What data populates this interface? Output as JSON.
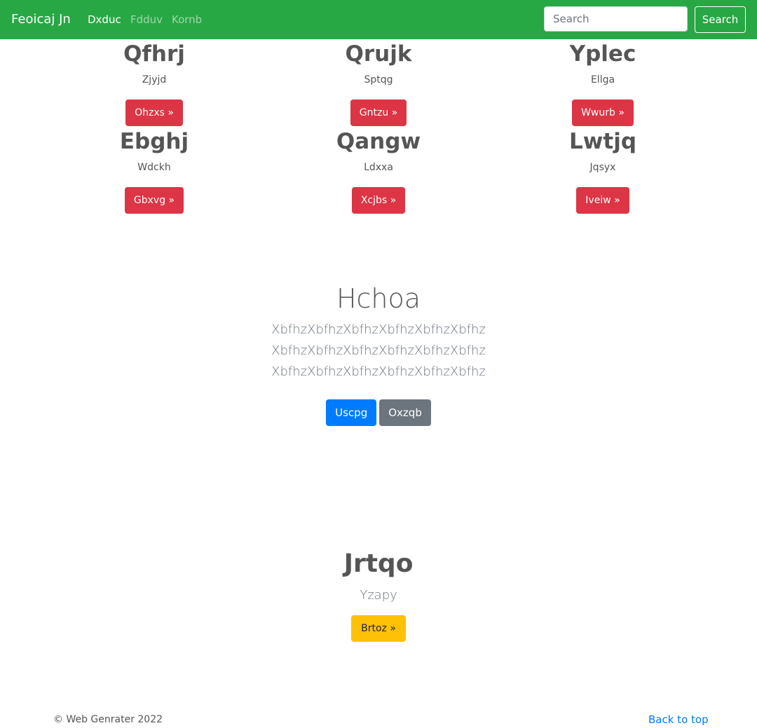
{
  "navbar": {
    "brand": "Feoicaj Jn",
    "links": [
      {
        "label": "Dxduc",
        "active": true
      },
      {
        "label": "Fdduv",
        "active": false
      },
      {
        "label": "Kornb",
        "active": false
      }
    ],
    "search_placeholder": "Search",
    "search_button": "Search",
    "color": "#28a745"
  },
  "cards": [
    {
      "title": "Qfhrj",
      "text": "Zjyjd",
      "button": "Ohzxs »"
    },
    {
      "title": "Qrujk",
      "text": "Sptqg",
      "button": "Gntzu »"
    },
    {
      "title": "Yplec",
      "text": "Ellga",
      "button": "Wwurb »"
    },
    {
      "title": "Ebghj",
      "text": "Wdckh",
      "button": "Gbxvg »"
    },
    {
      "title": "Qangw",
      "text": "Ldxxa",
      "button": "Xcjbs »"
    },
    {
      "title": "Lwtjq",
      "text": "Jqsyx",
      "button": "Iveiw »"
    }
  ],
  "hero": {
    "title": "Hchoa",
    "lead": "XbfhzXbfhzXbfhzXbfhzXbfhzXbfhz XbfhzXbfhzXbfhzXbfhzXbfhzXbfhz XbfhzXbfhzXbfhzXbfhzXbfhzXbfhz",
    "primary_button": "Uscpg",
    "secondary_button": "Oxzqb"
  },
  "feature": {
    "title": "Jrtqo",
    "text": "Yzapy",
    "button": "Brtoz »"
  },
  "footer": {
    "copyright": "© Web Genrater 2022",
    "back_to_top": "Back to top"
  }
}
